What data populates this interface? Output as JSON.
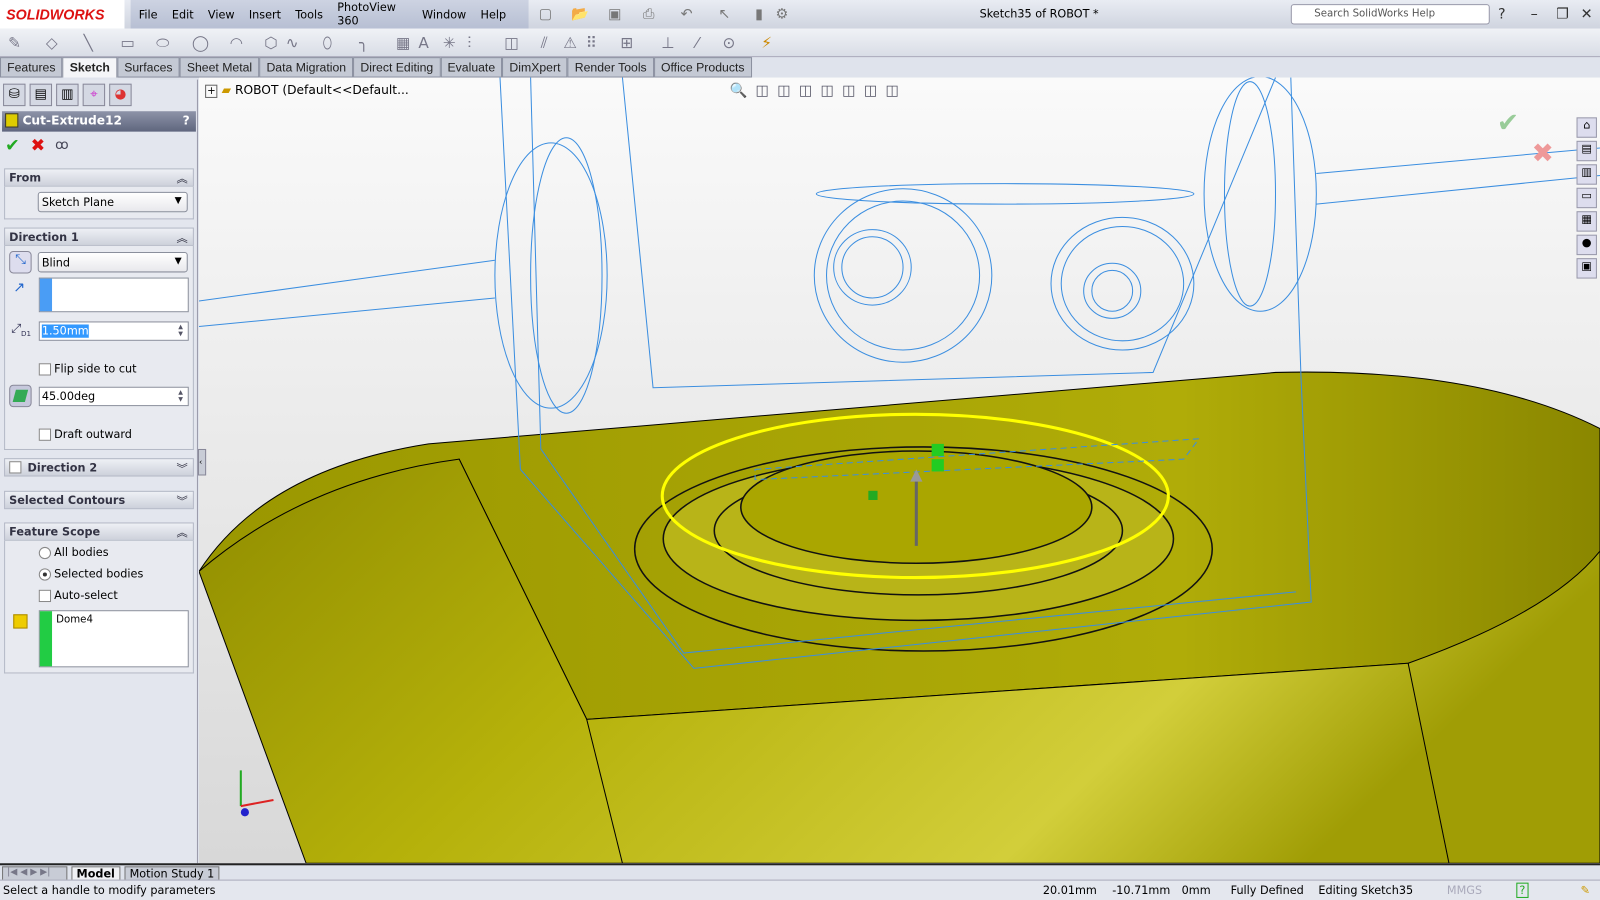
{
  "app": {
    "brand": "SOLIDWORKS",
    "doc_title": "Sketch35 of ROBOT *",
    "search_placeholder": "Search SolidWorks Help"
  },
  "menu": [
    "File",
    "Edit",
    "View",
    "Insert",
    "Tools",
    "PhotoView 360",
    "Window",
    "Help"
  ],
  "tabs": [
    "Features",
    "Sketch",
    "Surfaces",
    "Sheet Metal",
    "Data Migration",
    "Direct Editing",
    "Evaluate",
    "DimXpert",
    "Render Tools",
    "Office Products"
  ],
  "active_tab": "Sketch",
  "tree": {
    "root": "ROBOT  (Default<<Default..."
  },
  "property_manager": {
    "title": "Cut-Extrude12",
    "help": "?",
    "from": {
      "header": "From",
      "value": "Sketch Plane"
    },
    "direction1": {
      "header": "Direction 1",
      "end_condition": "Blind",
      "depth": "1.50mm",
      "flip_label": "Flip side to cut",
      "flip_checked": false,
      "draft_angle": "45.00deg",
      "draft_outward_label": "Draft outward",
      "draft_outward_checked": false
    },
    "direction2": {
      "header": "Direction 2"
    },
    "selected_contours": {
      "header": "Selected Contours"
    },
    "feature_scope": {
      "header": "Feature Scope",
      "all_bodies": "All bodies",
      "selected_bodies": "Selected bodies",
      "selected": "Selected bodies",
      "auto_select": "Auto-select",
      "bodies": [
        "Dome4"
      ]
    }
  },
  "bottom_tabs": [
    "Model",
    "Motion Study 1"
  ],
  "status": {
    "message": "Select a handle to modify parameters",
    "x": "20.01mm",
    "y": "-10.71mm",
    "z": "0mm",
    "state": "Fully Defined",
    "editing": "Editing Sketch35",
    "units": "MMGS"
  },
  "colors": {
    "model": "#a8a400",
    "sketch_highlight": "#ffff00",
    "wireframe": "#3b8ee0",
    "accent_red": "#d11111"
  }
}
